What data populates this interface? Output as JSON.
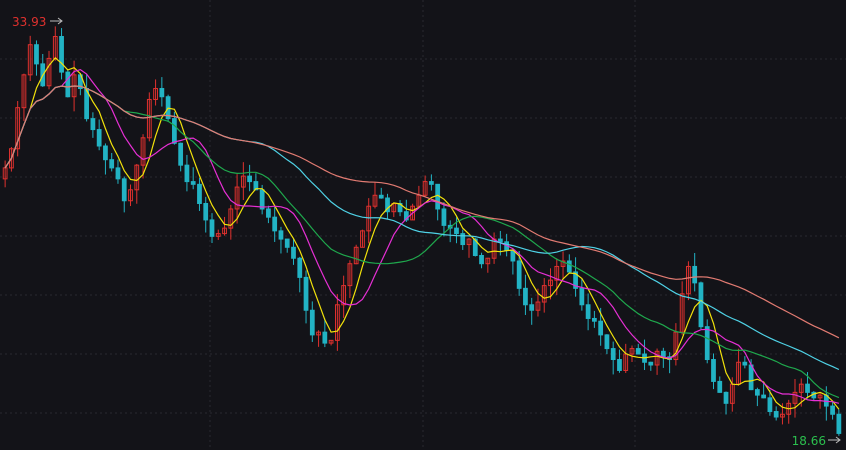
{
  "chart_data": {
    "type": "candlestick",
    "price_high_label": "33.93",
    "price_low_label": "18.66",
    "y_range": [
      18.66,
      33.93
    ],
    "grid": true,
    "colors": {
      "background": "#131318",
      "grid": "#2a2a30",
      "up": "#e0312e",
      "down": "#22b3c4",
      "high_label": "#e0312e",
      "low_label": "#2bbf4e",
      "marker": "#bbbbbb",
      "ma5": "#f2e20b",
      "ma10": "#e62fd4",
      "ma20": "#1fa84d",
      "ma40": "#4fd2e6",
      "ma60": "#e27b72"
    },
    "ma_periods": [
      5,
      10,
      20,
      40,
      60
    ],
    "closes": [
      28.6,
      29.3,
      30.8,
      32.0,
      33.1,
      32.4,
      31.6,
      32.6,
      33.4,
      32.1,
      31.2,
      32.0,
      31.5,
      30.4,
      30.0,
      29.4,
      28.9,
      28.6,
      28.2,
      27.4,
      27.8,
      28.7,
      29.7,
      31.1,
      31.5,
      31.2,
      30.4,
      29.5,
      28.7,
      28.1,
      28.0,
      27.3,
      26.7,
      26.1,
      26.2,
      26.4,
      27.1,
      27.9,
      28.3,
      28.1,
      27.8,
      27.1,
      26.8,
      26.3,
      26.0,
      25.7,
      25.3,
      24.6,
      23.4,
      22.5,
      22.6,
      22.2,
      22.3,
      23.6,
      24.3,
      25.1,
      25.7,
      26.3,
      27.2,
      27.6,
      27.5,
      27.0,
      27.3,
      27.0,
      26.7,
      27.2,
      27.6,
      28.1,
      28.0,
      27.1,
      26.5,
      26.4,
      26.2,
      25.8,
      26.0,
      25.4,
      25.1,
      25.3,
      26.0,
      25.9,
      25.6,
      25.2,
      24.2,
      23.6,
      23.4,
      23.7,
      24.3,
      24.5,
      25.0,
      25.2,
      24.8,
      24.2,
      23.6,
      23.1,
      23.0,
      22.5,
      22.0,
      21.6,
      21.2,
      21.8,
      22.0,
      21.8,
      21.5,
      21.4,
      21.9,
      21.7,
      21.6,
      22.6,
      24.0,
      25.0,
      24.4,
      22.8,
      21.6,
      20.8,
      20.4,
      20.0,
      20.7,
      21.5,
      21.4,
      20.5,
      20.3,
      20.2,
      19.7,
      19.5,
      19.6,
      20.0,
      20.4,
      20.7,
      20.4,
      20.2,
      20.3,
      19.9,
      19.6,
      18.9
    ]
  }
}
